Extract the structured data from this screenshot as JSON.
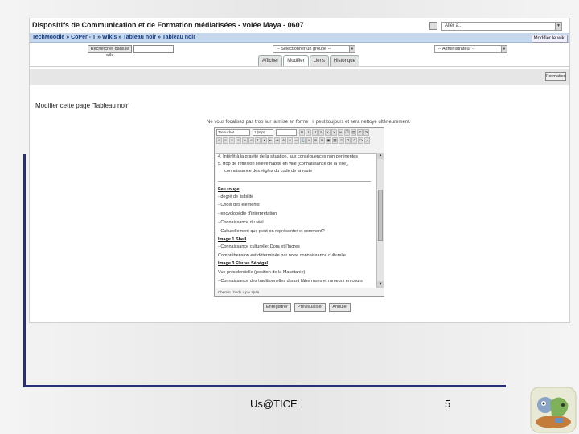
{
  "site": {
    "title": "Dispositifs de Communication et de Formation médiatisées - volée Maya - 0607",
    "language_select": "Aller à...",
    "breadcrumb": "TechMoodle » CoPer - T » Wikis » Tableau noir » Tableau noir",
    "edit_mode": "Modifier le wiki"
  },
  "toolbar": {
    "search_button": "Rechercher dans le wiki",
    "search_value": "",
    "group_select": "-- Sélectionner un groupe --",
    "user_select": "-- Administrateur --"
  },
  "tabs": [
    {
      "label": "Afficher",
      "active": false
    },
    {
      "label": "Modifier",
      "active": true
    },
    {
      "label": "Liens",
      "active": false
    },
    {
      "label": "Historique",
      "active": false
    }
  ],
  "turn_editing_button": "Formation",
  "page_heading": "Modifier cette page 'Tableau noir'",
  "editor": {
    "notice": "Ne vous focalisez pas trop sur la mise en forme : il peut toujours et sera nettoyé ultérieurement.",
    "format_select": "Trebuchet",
    "size_select": "1 (8 pt)",
    "style_select": "",
    "lines": [
      {
        "text": "4. Intérêt à la gravité de la situation, aux conséquences non pertinentes",
        "bold": false
      },
      {
        "text": "5. trop de réflexion l'élève habite en ville (connaissance de la ville),",
        "bold": false
      },
      {
        "text": "connaissance des règles du code de la route",
        "bold": false
      },
      {
        "text": "Feu rouge",
        "bold": true
      },
      {
        "text": "- degré de lisibilité",
        "bold": false
      },
      {
        "text": "- Choix des éléments",
        "bold": false
      },
      {
        "text": "- encyclopédie d'interprétation",
        "bold": false
      },
      {
        "text": "- Connaissance du réel",
        "bold": false
      },
      {
        "text": "- Culturellement que peut-on représenter et comment?",
        "bold": false
      },
      {
        "text": "Image 1 Shell",
        "bold": true
      },
      {
        "text": "- Connaissance culturelle: Dora et l'Ingres",
        "bold": false
      },
      {
        "text": "Compréhension est déterminée par notre connaissance culturelle.",
        "bold": false
      },
      {
        "text": "Image 3 Fleuve Sénégal",
        "bold": true
      },
      {
        "text": "Vue présidentielle (position de la Mauritanie)",
        "bold": false
      },
      {
        "text": "- Connaissance des traditionnelles durant l'âtre ruses et rumeurs en cours",
        "bold": false
      }
    ],
    "status_path": "Chemin : body » p » span"
  },
  "form_buttons": {
    "save": "Enregistrer",
    "preview": "Prévisualiser",
    "cancel": "Annuler"
  },
  "slide": {
    "footer": "Us@TICE",
    "page_number": "5"
  },
  "icons": [
    "mascot-icon"
  ]
}
